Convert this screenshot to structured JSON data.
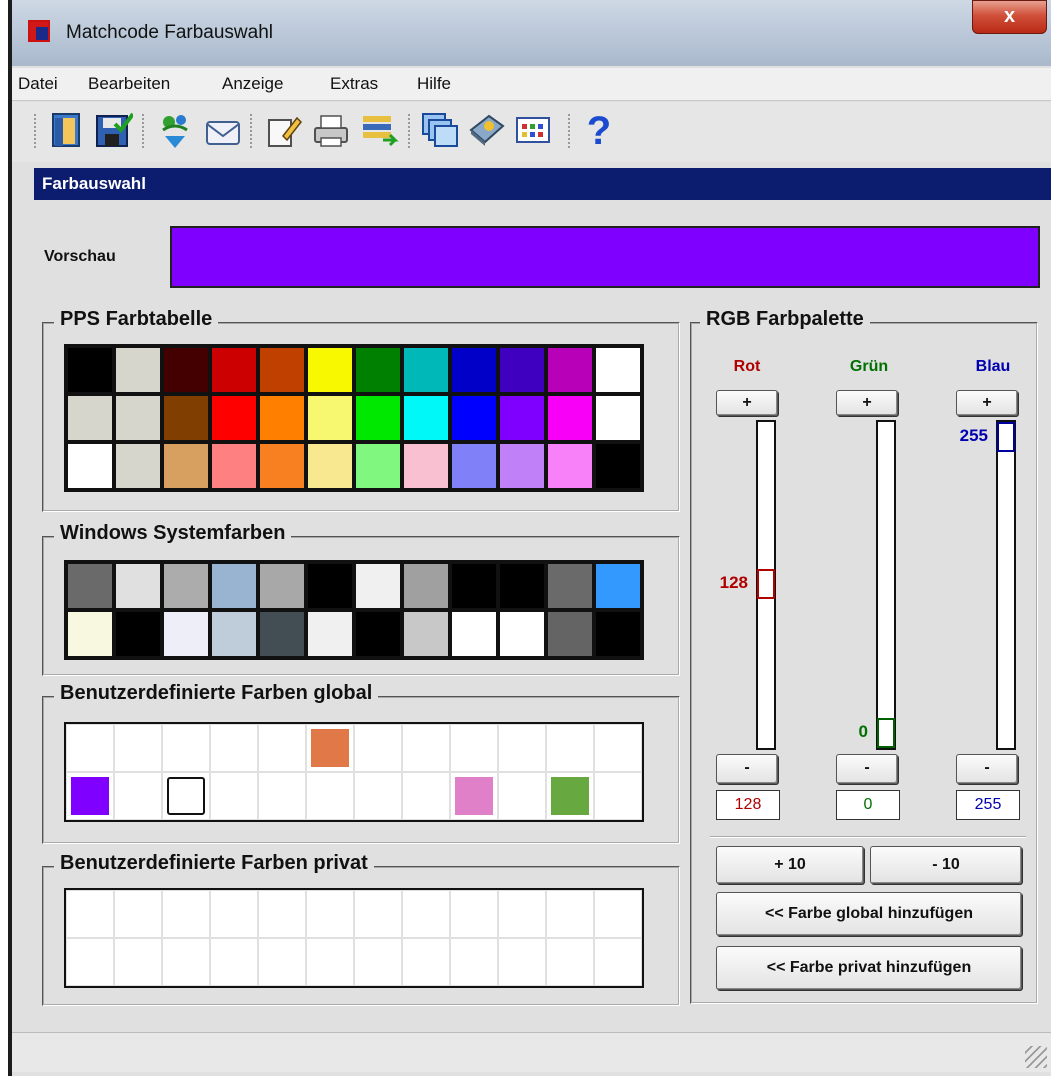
{
  "window": {
    "title": "Matchcode Farbauswahl",
    "close_label": "x"
  },
  "menu": [
    "Datei",
    "Bearbeiten",
    "Anzeige",
    "Extras",
    "Hilfe"
  ],
  "toolbar_icons": [
    "exit-icon",
    "save-icon",
    "refresh-icon",
    "mail-icon",
    "edit-icon",
    "print-icon",
    "export-icon",
    "windows-icon",
    "book-icon",
    "grid-icon",
    "help-icon"
  ],
  "section": {
    "title": "Farbauswahl"
  },
  "preview": {
    "label": "Vorschau",
    "color": "#8000ff"
  },
  "pps": {
    "title": "PPS Farbtabelle",
    "rows": [
      [
        "#000000",
        "#d6d6cc",
        "#440000",
        "#cc0000",
        "#c04000",
        "#f8f800",
        "#008000",
        "#00b8b8",
        "#0000c8",
        "#4000c0",
        "#b800b8",
        "#ffffff"
      ],
      [
        "#d6d6cc",
        "#d6d6cc",
        "#803f00",
        "#ff0000",
        "#ff8000",
        "#f8f870",
        "#00e800",
        "#00f8f8",
        "#0000ff",
        "#8000ff",
        "#f800f8",
        "#ffffff"
      ],
      [
        "#ffffff",
        "#d6d6cc",
        "#d8a060",
        "#ff8080",
        "#f88020",
        "#f8e890",
        "#80f880",
        "#f8c0d0",
        "#8080f8",
        "#c080f8",
        "#f880f8",
        "#000000"
      ]
    ]
  },
  "system": {
    "title": "Windows Systemfarben",
    "rows": [
      [
        "#6a6a6a",
        "#e0e0e0",
        "#acacac",
        "#99b4d1",
        "#a8a8a8",
        "#000000",
        "#f0f0f0",
        "#a0a0a0",
        "#000000",
        "#000000",
        "#6a6a6a",
        "#3399ff"
      ],
      [
        "#f8f8e0",
        "#000000",
        "#eeeef8",
        "#bfcddb",
        "#434e54",
        "#f0f0f0",
        "#000000",
        "#c8c8c8",
        "#ffffff",
        "#ffffff",
        "#646464",
        "#000000"
      ]
    ]
  },
  "global": {
    "title": "Benutzerdefinierte Farben global",
    "cells": [
      [
        null,
        null,
        null,
        null,
        null,
        "#e07848",
        null,
        null,
        null,
        null,
        null,
        null
      ],
      [
        "#8000ff",
        null,
        "#ffffff",
        null,
        null,
        null,
        null,
        null,
        "#e080c8",
        null,
        "#68a840",
        null
      ]
    ]
  },
  "private": {
    "title": "Benutzerdefinierte Farben privat",
    "rows": 2,
    "cols": 12
  },
  "rgb": {
    "title": "RGB Farbpalette",
    "red": {
      "label": "Rot",
      "value": "128",
      "value_num": 128,
      "color": "#b00000"
    },
    "green": {
      "label": "Grün",
      "value": "0",
      "value_num": 0,
      "color": "#007000"
    },
    "blue": {
      "label": "Blau",
      "value": "255",
      "value_num": 255,
      "color": "#0000b0"
    },
    "plus": "+",
    "minus": "-",
    "plus10": "+ 10",
    "minus10": "- 10",
    "add_global": "<< Farbe global hinzufügen",
    "add_private": "<< Farbe privat hinzufügen"
  }
}
